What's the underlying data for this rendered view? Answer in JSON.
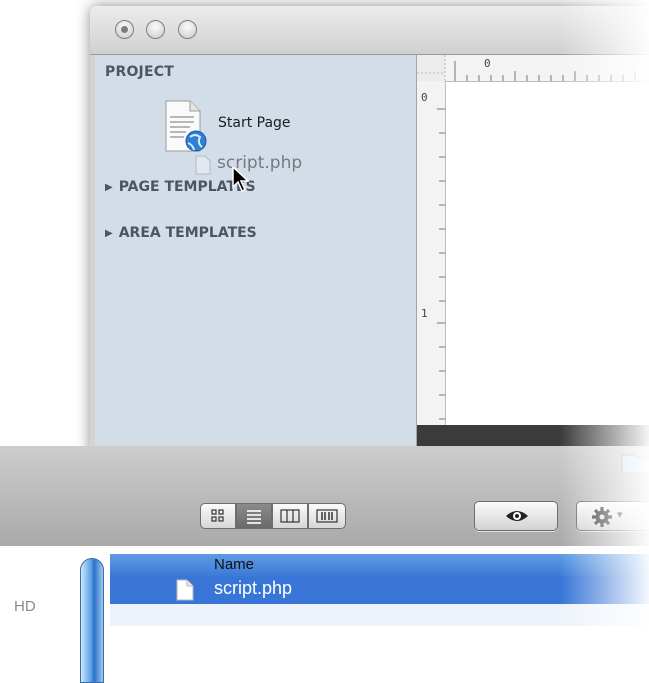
{
  "sidebar": {
    "project_heading": "PROJECT",
    "start_page_label": "Start Page",
    "dragged_file_label": "script.php",
    "groups": [
      {
        "label": "PAGE TEMPLATES"
      },
      {
        "label": "AREA TEMPLATES"
      }
    ]
  },
  "ruler": {
    "top_zero": "0",
    "left_zero": "0",
    "left_one": "1"
  },
  "finder": {
    "sidebar_partial_label": "HD",
    "list": {
      "column_name": "Name",
      "rows": [
        {
          "name": "script.php",
          "selected": true
        }
      ]
    },
    "view_buttons": [
      "icon-view",
      "list-view",
      "column-view",
      "cover-flow-view"
    ],
    "active_view": "list-view"
  },
  "colors": {
    "sidebar_bg": "#d2dde8",
    "selection_blue": "#3875d7",
    "heading_text": "#4b5663"
  }
}
